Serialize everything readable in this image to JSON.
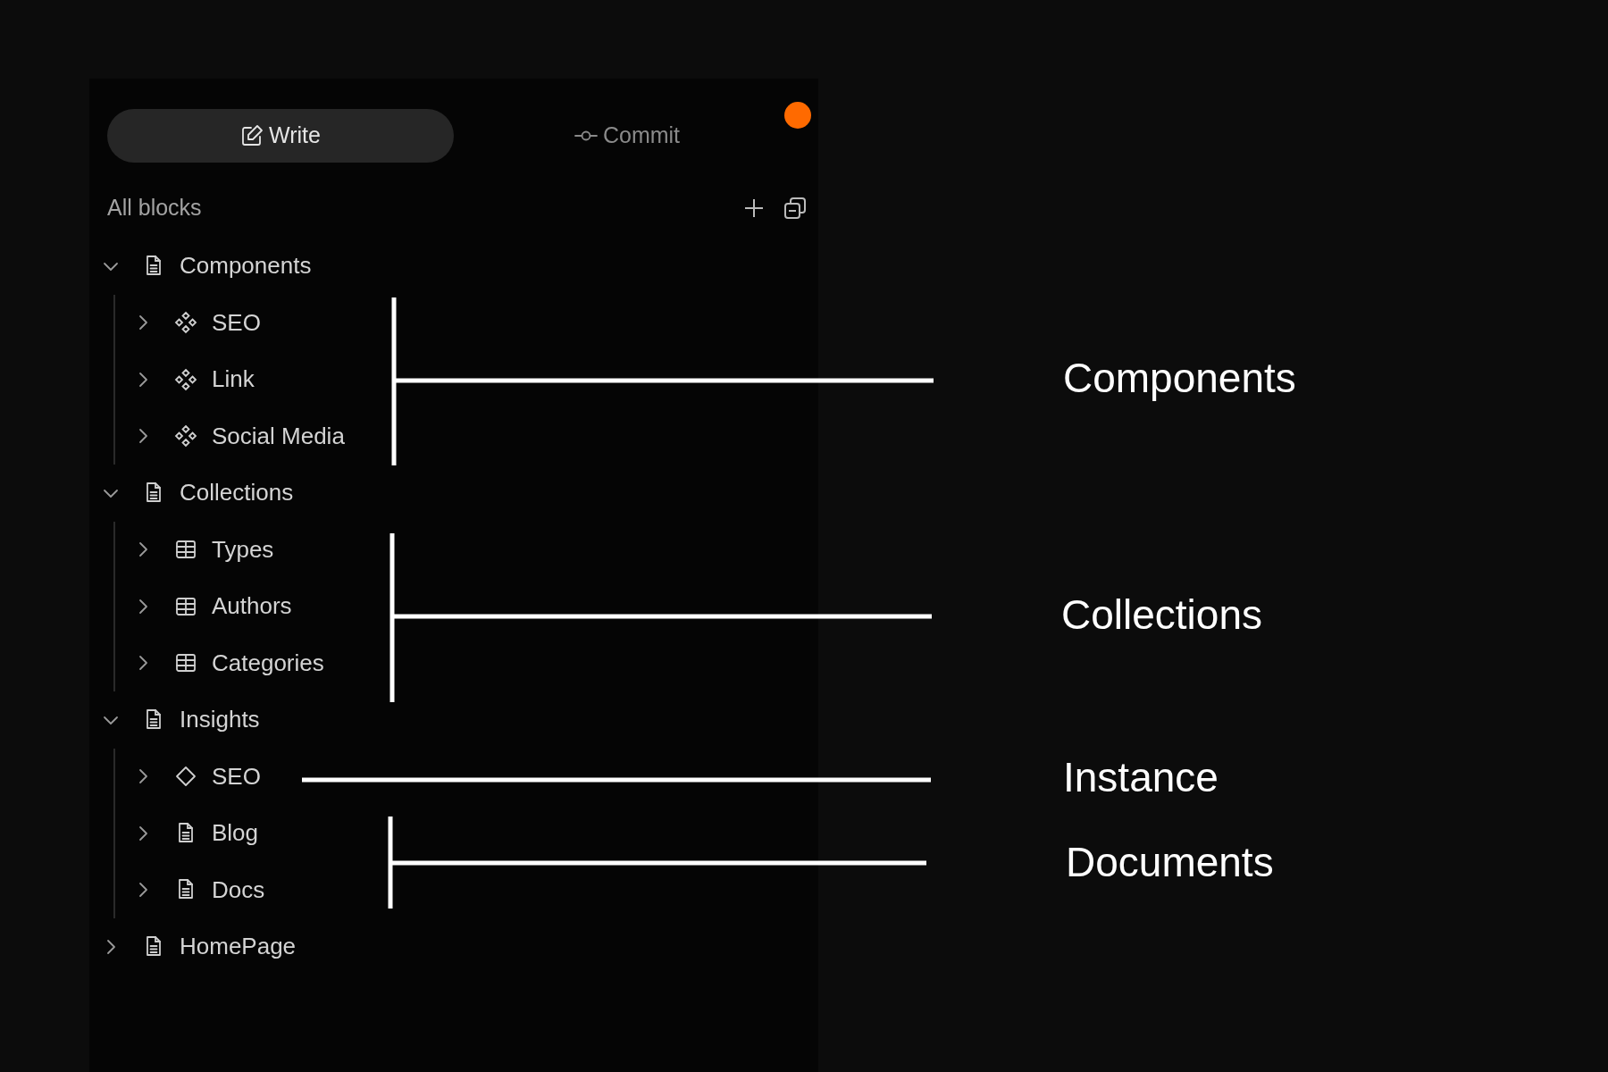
{
  "tabs": [
    {
      "label": "Write",
      "kind": "edit",
      "selected": true
    },
    {
      "label": "Commit",
      "kind": "commit",
      "selected": false
    }
  ],
  "notification_dot": {
    "color": "#ff6a00"
  },
  "header": {
    "title": "All blocks"
  },
  "tree": [
    {
      "label": "Components",
      "kind": "page",
      "expanded": true,
      "children": [
        {
          "label": "SEO",
          "kind": "component",
          "expanded": false
        },
        {
          "label": "Link",
          "kind": "component",
          "expanded": false
        },
        {
          "label": "Social Media",
          "kind": "component",
          "expanded": false
        }
      ]
    },
    {
      "label": "Collections",
      "kind": "page",
      "expanded": true,
      "children": [
        {
          "label": "Types",
          "kind": "table",
          "expanded": false
        },
        {
          "label": "Authors",
          "kind": "table",
          "expanded": false
        },
        {
          "label": "Categories",
          "kind": "table",
          "expanded": false
        }
      ]
    },
    {
      "label": "Insights",
      "kind": "page",
      "expanded": true,
      "children": [
        {
          "label": "SEO",
          "kind": "instance",
          "expanded": false
        },
        {
          "label": "Blog",
          "kind": "page",
          "expanded": false
        },
        {
          "label": "Docs",
          "kind": "page",
          "expanded": false
        }
      ]
    },
    {
      "label": "HomePage",
      "kind": "page",
      "expanded": false
    }
  ],
  "annotations": [
    {
      "label": "Components"
    },
    {
      "label": "Collections"
    },
    {
      "label": "Instance"
    },
    {
      "label": "Documents"
    }
  ]
}
